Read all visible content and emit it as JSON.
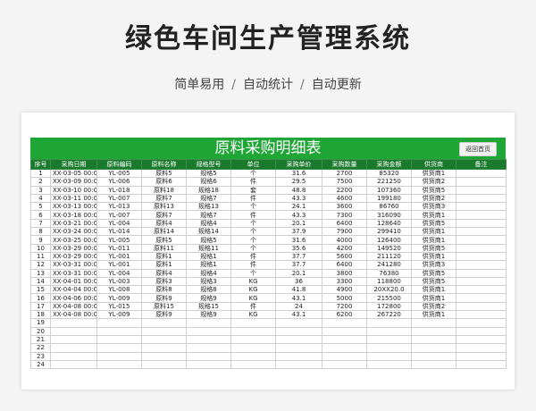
{
  "header": {
    "title": "绿色车间生产管理系统",
    "tags": [
      "简单易用",
      "自动统计",
      "自动更新"
    ],
    "separator": "/"
  },
  "sheet": {
    "title": "原料采购明细表",
    "back_button": "返回首页",
    "columns": [
      "序号",
      "采购日期",
      "原料编码",
      "原料名称",
      "规格型号",
      "单位",
      "采购单价",
      "采购数量",
      "采购金额",
      "供货商",
      "备注"
    ],
    "rows": [
      [
        "1",
        "XX-03-05 00:00",
        "YL-005",
        "原料5",
        "规格5",
        "个",
        "31.6",
        "2700",
        "85320",
        "供货商1",
        ""
      ],
      [
        "2",
        "XX-03-09 00:00",
        "YL-006",
        "原料6",
        "规格6",
        "件",
        "29.5",
        "7500",
        "221250",
        "供货商2",
        ""
      ],
      [
        "3",
        "XX-03-10 00:00",
        "YL-018",
        "原料18",
        "规格18",
        "套",
        "48.8",
        "2200",
        "107360",
        "供货商5",
        ""
      ],
      [
        "4",
        "XX-03-11 00:00",
        "YL-007",
        "原料7",
        "规格7",
        "件",
        "43.3",
        "4600",
        "199180",
        "供货商2",
        ""
      ],
      [
        "5",
        "XX-03-13 00:00",
        "YL-013",
        "原料13",
        "规格13",
        "个",
        "24.1",
        "3600",
        "86760",
        "供货商3",
        ""
      ],
      [
        "6",
        "XX-03-18 00:00",
        "YL-007",
        "原料7",
        "规格7",
        "件",
        "43.3",
        "7300",
        "316090",
        "供货商1",
        ""
      ],
      [
        "7",
        "XX-03-21 00:00",
        "YL-004",
        "原料4",
        "规格4",
        "个",
        "20.1",
        "6400",
        "128640",
        "供货商5",
        ""
      ],
      [
        "8",
        "XX-03-24 00:00",
        "YL-014",
        "原料14",
        "规格14",
        "个",
        "37.9",
        "7900",
        "299410",
        "供货商1",
        ""
      ],
      [
        "9",
        "XX-03-25 00:00",
        "YL-005",
        "原料5",
        "规格5",
        "个",
        "31.6",
        "4000",
        "126400",
        "供货商1",
        ""
      ],
      [
        "10",
        "XX-03-29 00:00",
        "YL-011",
        "原料11",
        "规格11",
        "个",
        "35.6",
        "4200",
        "149520",
        "供货商5",
        ""
      ],
      [
        "11",
        "XX-03-29 00:00",
        "YL-001",
        "原料1",
        "规格1",
        "件",
        "37.7",
        "5600",
        "211120",
        "供货商1",
        ""
      ],
      [
        "12",
        "XX-03-31 00:00",
        "YL-001",
        "原料1",
        "规格1",
        "件",
        "37.7",
        "6400",
        "241280",
        "供货商3",
        ""
      ],
      [
        "13",
        "XX-03-31 00:00",
        "YL-004",
        "原料4",
        "规格4",
        "个",
        "20.1",
        "3800",
        "76380",
        "供货商5",
        ""
      ],
      [
        "14",
        "XX-04-01 00:00",
        "YL-003",
        "原料3",
        "规格3",
        "KG",
        "36",
        "3300",
        "118800",
        "供货商5",
        ""
      ],
      [
        "15",
        "XX-04-04 00:00",
        "YL-008",
        "原料8",
        "规格8",
        "KG",
        "41.8",
        "4900",
        "20XX20.0",
        "供货商1",
        ""
      ],
      [
        "16",
        "XX-04-06 00:00",
        "YL-009",
        "原料9",
        "规格9",
        "KG",
        "43.1",
        "5000",
        "215500",
        "供货商1",
        ""
      ],
      [
        "17",
        "XX-04-08 00:00",
        "YL-015",
        "原料15",
        "规格15",
        "件",
        "24",
        "7200",
        "172800",
        "供货商2",
        ""
      ],
      [
        "18",
        "XX-04-08 00:00",
        "YL-009",
        "原料9",
        "规格9",
        "KG",
        "43.1",
        "6200",
        "267220",
        "供货商1",
        ""
      ],
      [
        "19",
        "",
        "",
        "",
        "",
        "",
        "",
        "",
        "",
        "",
        ""
      ],
      [
        "20",
        "",
        "",
        "",
        "",
        "",
        "",
        "",
        "",
        "",
        ""
      ],
      [
        "21",
        "",
        "",
        "",
        "",
        "",
        "",
        "",
        "",
        "",
        ""
      ],
      [
        "22",
        "",
        "",
        "",
        "",
        "",
        "",
        "",
        "",
        "",
        ""
      ],
      [
        "23",
        "",
        "",
        "",
        "",
        "",
        "",
        "",
        "",
        "",
        ""
      ],
      [
        "24",
        "",
        "",
        "",
        "",
        "",
        "",
        "",
        "",
        "",
        ""
      ]
    ]
  },
  "colors": {
    "banner": "#1fa637",
    "header_row": "#1a7a2b"
  }
}
